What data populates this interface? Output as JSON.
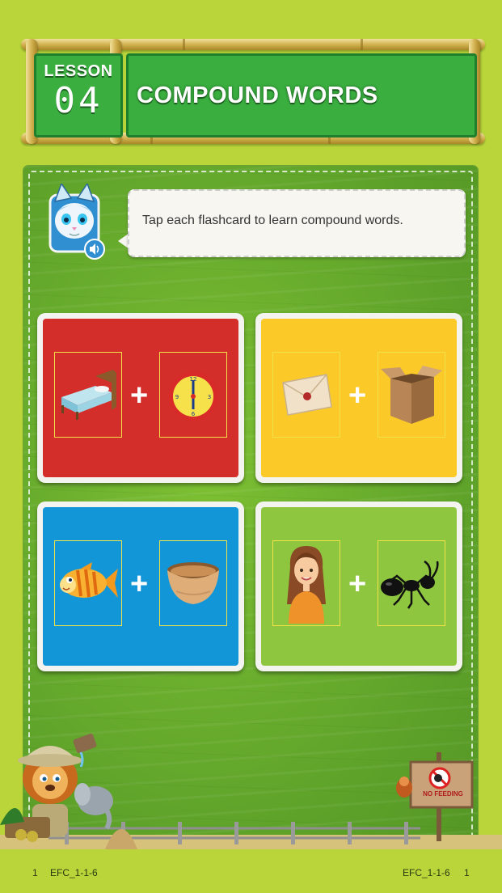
{
  "header": {
    "lesson_label": "LESSON",
    "lesson_number": "04",
    "title": "COMPOUND WORDS"
  },
  "instruction": {
    "text": "Tap each flashcard to learn compound words.",
    "avatar_icon": "cat-guide-avatar",
    "audio_icon": "speaker-icon"
  },
  "flashcards": [
    {
      "color": "#d42e2a",
      "left_icon": "bed-icon",
      "right_icon": "clock-icon"
    },
    {
      "color": "#fbc928",
      "left_icon": "envelope-icon",
      "right_icon": "box-icon"
    },
    {
      "color": "#1296d8",
      "left_icon": "fish-icon",
      "right_icon": "bowl-icon"
    },
    {
      "color": "#8ec63f",
      "left_icon": "woman-icon",
      "right_icon": "ant-icon"
    }
  ],
  "scene": {
    "sign_text": "NO FEEDING"
  },
  "footer": {
    "left_page": "1",
    "left_code": "EFC_1-1-6",
    "right_code": "EFC_1-1-6",
    "right_page": "1"
  }
}
